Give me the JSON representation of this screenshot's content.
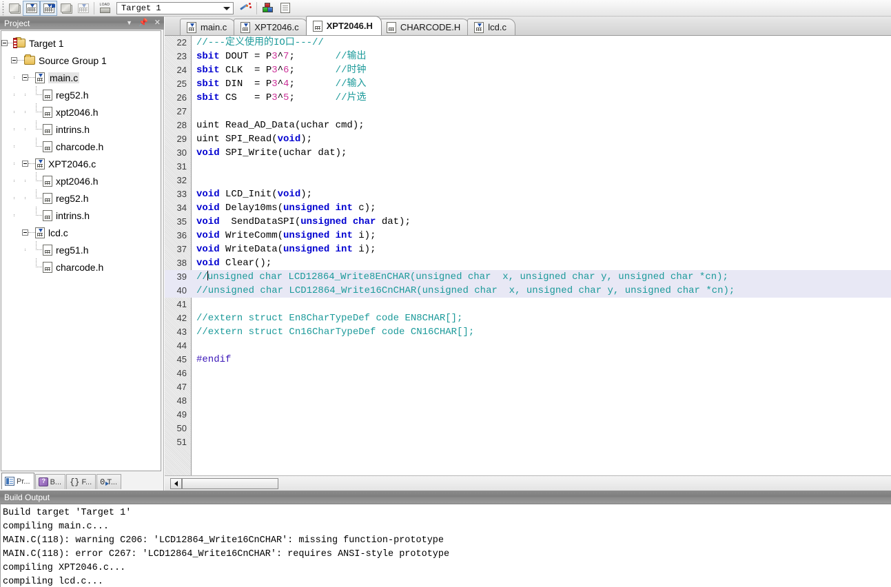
{
  "toolbar": {
    "buttons": [
      {
        "name": "translate-icon",
        "title": "Translate"
      },
      {
        "name": "build-icon",
        "title": "Build"
      },
      {
        "name": "rebuild-all-icon",
        "title": "Rebuild all target files"
      },
      {
        "name": "batch-build-icon",
        "title": "Batch Build"
      },
      {
        "name": "stop-build-icon",
        "title": "Stop build"
      },
      {
        "name": "download-icon",
        "title": "Download"
      }
    ],
    "target_select": {
      "value": "Target 1",
      "placeholder": "Target 1"
    },
    "wand_icon": "target-options-wand-icon",
    "components_icon": "manage-components-icon",
    "books_icon": "books-icon"
  },
  "project_panel": {
    "title": "Project",
    "header_icons": [
      "chevron-down-icon",
      "pin-icon",
      "close-icon"
    ],
    "tree": [
      {
        "label": "Target 1",
        "indent": 0,
        "icon": "target-folder",
        "expander": true,
        "selected": false
      },
      {
        "label": "Source Group 1",
        "indent": 1,
        "icon": "folder",
        "expander": true,
        "selected": false
      },
      {
        "label": "main.c",
        "indent": 2,
        "icon": "c-file",
        "expander": true,
        "selected": true
      },
      {
        "label": "reg52.h",
        "indent": 3,
        "icon": "h-file",
        "expander": false,
        "selected": false
      },
      {
        "label": "xpt2046.h",
        "indent": 3,
        "icon": "h-file",
        "expander": false,
        "selected": false
      },
      {
        "label": "intrins.h",
        "indent": 3,
        "icon": "h-file",
        "expander": false,
        "selected": false
      },
      {
        "label": "charcode.h",
        "indent": 3,
        "icon": "h-file",
        "expander": false,
        "selected": false
      },
      {
        "label": "XPT2046.c",
        "indent": 2,
        "icon": "c-file",
        "expander": true,
        "selected": false
      },
      {
        "label": "xpt2046.h",
        "indent": 3,
        "icon": "h-file",
        "expander": false,
        "selected": false
      },
      {
        "label": "reg52.h",
        "indent": 3,
        "icon": "h-file",
        "expander": false,
        "selected": false
      },
      {
        "label": "intrins.h",
        "indent": 3,
        "icon": "h-file",
        "expander": false,
        "selected": false
      },
      {
        "label": "lcd.c",
        "indent": 2,
        "icon": "c-file",
        "expander": true,
        "selected": false
      },
      {
        "label": "reg51.h",
        "indent": 3,
        "icon": "h-file",
        "expander": false,
        "selected": false
      },
      {
        "label": "charcode.h",
        "indent": 3,
        "icon": "h-file",
        "expander": false,
        "selected": false
      }
    ],
    "bottom_tabs": [
      {
        "label": "Pr...",
        "icon": "project-window-icon",
        "active": true
      },
      {
        "label": "B...",
        "icon": "books-icon",
        "active": false
      },
      {
        "label": "F...",
        "icon": "functions-brace-icon",
        "active": false
      },
      {
        "label": "T...",
        "icon": "templates-icon",
        "active": false
      }
    ]
  },
  "editor": {
    "tabs": [
      {
        "label": "main.c",
        "icon": "c-file",
        "active": false
      },
      {
        "label": "XPT2046.c",
        "icon": "c-file",
        "active": false
      },
      {
        "label": "XPT2046.H",
        "icon": "h-file",
        "active": true
      },
      {
        "label": "CHARCODE.H",
        "icon": "blank-file",
        "active": false
      },
      {
        "label": "lcd.c",
        "icon": "c-file",
        "active": false
      }
    ],
    "first_line_number": 22,
    "lines": [
      {
        "n": 22,
        "highlight": false,
        "spans": [
          {
            "c": "cmt",
            "t": "//---定义使用的IO口---//"
          }
        ]
      },
      {
        "n": 23,
        "highlight": false,
        "spans": [
          {
            "c": "key",
            "t": "sbit"
          },
          {
            "c": "txt",
            "t": " DOUT = P"
          },
          {
            "c": "num",
            "t": "3"
          },
          {
            "c": "txt",
            "t": "^"
          },
          {
            "c": "num",
            "t": "7"
          },
          {
            "c": "txt",
            "t": ";       "
          },
          {
            "c": "cmt",
            "t": "//输出"
          }
        ]
      },
      {
        "n": 24,
        "highlight": false,
        "spans": [
          {
            "c": "key",
            "t": "sbit"
          },
          {
            "c": "txt",
            "t": " CLK  = P"
          },
          {
            "c": "num",
            "t": "3"
          },
          {
            "c": "txt",
            "t": "^"
          },
          {
            "c": "num",
            "t": "6"
          },
          {
            "c": "txt",
            "t": ";       "
          },
          {
            "c": "cmt",
            "t": "//时钟"
          }
        ]
      },
      {
        "n": 25,
        "highlight": false,
        "spans": [
          {
            "c": "key",
            "t": "sbit"
          },
          {
            "c": "txt",
            "t": " DIN  = P"
          },
          {
            "c": "num",
            "t": "3"
          },
          {
            "c": "txt",
            "t": "^"
          },
          {
            "c": "num",
            "t": "4"
          },
          {
            "c": "txt",
            "t": ";       "
          },
          {
            "c": "cmt",
            "t": "//输入"
          }
        ]
      },
      {
        "n": 26,
        "highlight": false,
        "spans": [
          {
            "c": "key",
            "t": "sbit"
          },
          {
            "c": "txt",
            "t": " CS   = P"
          },
          {
            "c": "num",
            "t": "3"
          },
          {
            "c": "txt",
            "t": "^"
          },
          {
            "c": "num",
            "t": "5"
          },
          {
            "c": "txt",
            "t": ";       "
          },
          {
            "c": "cmt",
            "t": "//片选"
          }
        ]
      },
      {
        "n": 27,
        "highlight": false,
        "spans": []
      },
      {
        "n": 28,
        "highlight": false,
        "spans": [
          {
            "c": "txt",
            "t": "uint Read_AD_Data(uchar cmd);"
          }
        ]
      },
      {
        "n": 29,
        "highlight": false,
        "spans": [
          {
            "c": "txt",
            "t": "uint SPI_Read("
          },
          {
            "c": "key",
            "t": "void"
          },
          {
            "c": "txt",
            "t": ");"
          }
        ]
      },
      {
        "n": 30,
        "highlight": false,
        "spans": [
          {
            "c": "key",
            "t": "void"
          },
          {
            "c": "txt",
            "t": " SPI_Write(uchar dat);"
          }
        ]
      },
      {
        "n": 31,
        "highlight": false,
        "spans": []
      },
      {
        "n": 32,
        "highlight": false,
        "spans": []
      },
      {
        "n": 33,
        "highlight": false,
        "spans": [
          {
            "c": "key",
            "t": "void"
          },
          {
            "c": "txt",
            "t": " LCD_Init("
          },
          {
            "c": "key",
            "t": "void"
          },
          {
            "c": "txt",
            "t": ");"
          }
        ]
      },
      {
        "n": 34,
        "highlight": false,
        "spans": [
          {
            "c": "key",
            "t": "void"
          },
          {
            "c": "txt",
            "t": " Delay10ms("
          },
          {
            "c": "key",
            "t": "unsigned int"
          },
          {
            "c": "txt",
            "t": " c);"
          }
        ]
      },
      {
        "n": 35,
        "highlight": false,
        "spans": [
          {
            "c": "key",
            "t": "void"
          },
          {
            "c": "txt",
            "t": "  SendDataSPI("
          },
          {
            "c": "key",
            "t": "unsigned char"
          },
          {
            "c": "txt",
            "t": " dat);"
          }
        ]
      },
      {
        "n": 36,
        "highlight": false,
        "spans": [
          {
            "c": "key",
            "t": "void"
          },
          {
            "c": "txt",
            "t": " WriteComm("
          },
          {
            "c": "key",
            "t": "unsigned int"
          },
          {
            "c": "txt",
            "t": " i);"
          }
        ]
      },
      {
        "n": 37,
        "highlight": false,
        "spans": [
          {
            "c": "key",
            "t": "void"
          },
          {
            "c": "txt",
            "t": " WriteData("
          },
          {
            "c": "key",
            "t": "unsigned int"
          },
          {
            "c": "txt",
            "t": " i);"
          }
        ]
      },
      {
        "n": 38,
        "highlight": false,
        "spans": [
          {
            "c": "key",
            "t": "void"
          },
          {
            "c": "txt",
            "t": " Clear();"
          }
        ]
      },
      {
        "n": 39,
        "highlight": true,
        "caret_after": 2,
        "spans": [
          {
            "c": "cmt",
            "t": "//unsigned char LCD12864_Write8EnCHAR(unsigned char  x, unsigned char y, unsigned char *cn);"
          }
        ]
      },
      {
        "n": 40,
        "highlight": true,
        "spans": [
          {
            "c": "cmt",
            "t": "//unsigned char LCD12864_Write16CnCHAR(unsigned char  x, unsigned char y, unsigned char *cn);"
          }
        ]
      },
      {
        "n": 41,
        "highlight": false,
        "spans": []
      },
      {
        "n": 42,
        "highlight": false,
        "spans": [
          {
            "c": "cmt",
            "t": "//extern struct En8CharTypeDef code EN8CHAR[];"
          }
        ]
      },
      {
        "n": 43,
        "highlight": false,
        "spans": [
          {
            "c": "cmt",
            "t": "//extern struct Cn16CharTypeDef code CN16CHAR[];"
          }
        ]
      },
      {
        "n": 44,
        "highlight": false,
        "spans": []
      },
      {
        "n": 45,
        "highlight": false,
        "spans": [
          {
            "c": "pre",
            "t": "#endif"
          }
        ]
      },
      {
        "n": 46,
        "highlight": false,
        "spans": []
      },
      {
        "n": 47,
        "highlight": false,
        "spans": []
      },
      {
        "n": 48,
        "highlight": false,
        "spans": []
      },
      {
        "n": 49,
        "highlight": false,
        "spans": []
      },
      {
        "n": 50,
        "highlight": false,
        "spans": []
      },
      {
        "n": 51,
        "highlight": false,
        "spans": []
      }
    ],
    "scrollbar": {
      "left_arrow": "scroll-left-arrow-icon"
    }
  },
  "annotation": {
    "shape": "red-handdrawn-arc",
    "color": "#d81f1f"
  },
  "build_output": {
    "title": "Build Output",
    "lines": [
      "Build target 'Target 1'",
      "compiling main.c...",
      "MAIN.C(118): warning C206: 'LCD12864_Write16CnCHAR': missing function-prototype",
      "MAIN.C(118): error C267: 'LCD12864_Write16CnCHAR': requires ANSI-style prototype",
      "compiling XPT2046.c...",
      "compiling lcd.c..."
    ]
  },
  "colors": {
    "comment": "#1c9a9a",
    "keyword": "#0000d0",
    "number": "#cc3399",
    "preproc": "#3a16b8",
    "highlight_line": "#e8e8f5",
    "panel_header": "#8a8a8a",
    "annotation_red": "#d81f1f"
  }
}
